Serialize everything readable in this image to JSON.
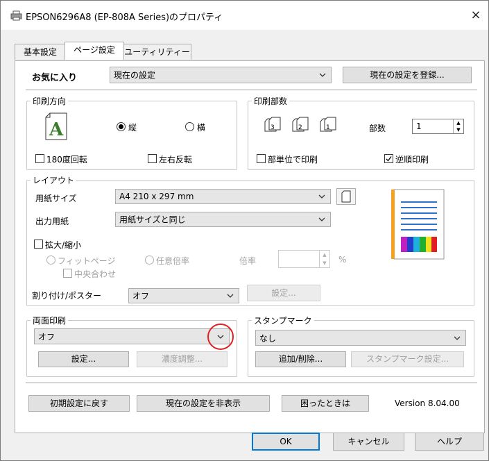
{
  "window": {
    "title": "EPSON6296A8 (EP-808A Series)のプロパティ",
    "close_glyph": "×"
  },
  "tabs": [
    {
      "label": "基本設定"
    },
    {
      "label": "ページ設定"
    },
    {
      "label": "ユーティリティー"
    }
  ],
  "favorites": {
    "label": "お気に入り",
    "value": "現在の設定",
    "register_button": "現在の設定を登録..."
  },
  "orientation": {
    "title": "印刷方向",
    "portrait": "縦",
    "landscape": "横",
    "rotate180": "180度回転",
    "mirror": "左右反転"
  },
  "copies": {
    "title": "印刷部数",
    "label": "部数",
    "value": "1",
    "collate": "部単位で印刷",
    "reverse": "逆順印刷"
  },
  "layout": {
    "title": "レイアウト",
    "paper_size_label": "用紙サイズ",
    "paper_size_value": "A4 210 x 297 mm",
    "output_paper_label": "出力用紙",
    "output_paper_value": "用紙サイズと同じ",
    "scale_label": "拡大/縮小",
    "fit_page": "フィットページ",
    "custom_scale": "任意倍率",
    "center": "中央合わせ",
    "ratio_label": "倍率",
    "ratio_unit": "%",
    "multipage_label": "割り付け/ポスター",
    "multipage_value": "オフ",
    "multipage_settings": "設定..."
  },
  "duplex": {
    "title": "両面印刷",
    "value": "オフ",
    "settings_button": "設定...",
    "density_button": "濃度調整..."
  },
  "stamp": {
    "title": "スタンプマーク",
    "value": "なし",
    "add_remove_button": "追加/削除...",
    "settings_button": "スタンプマーク設定..."
  },
  "footer": {
    "reset_button": "初期設定に戻す",
    "hide_button": "現在の設定を非表示",
    "help_button": "困ったときは",
    "version": "Version 8.04.00"
  },
  "dialog": {
    "ok": "OK",
    "cancel": "キャンセル",
    "help": "ヘルプ"
  },
  "colors": {
    "accent_blue": "#0078d7",
    "highlight_circle": "#e02020",
    "preview_orange": "#f4a020",
    "preview_blue": "#2f6fd0"
  },
  "icons": {
    "printer": "printer-icon",
    "close": "close-icon",
    "dropdown": "chevron-down-icon",
    "orientation_glyph": "A"
  }
}
